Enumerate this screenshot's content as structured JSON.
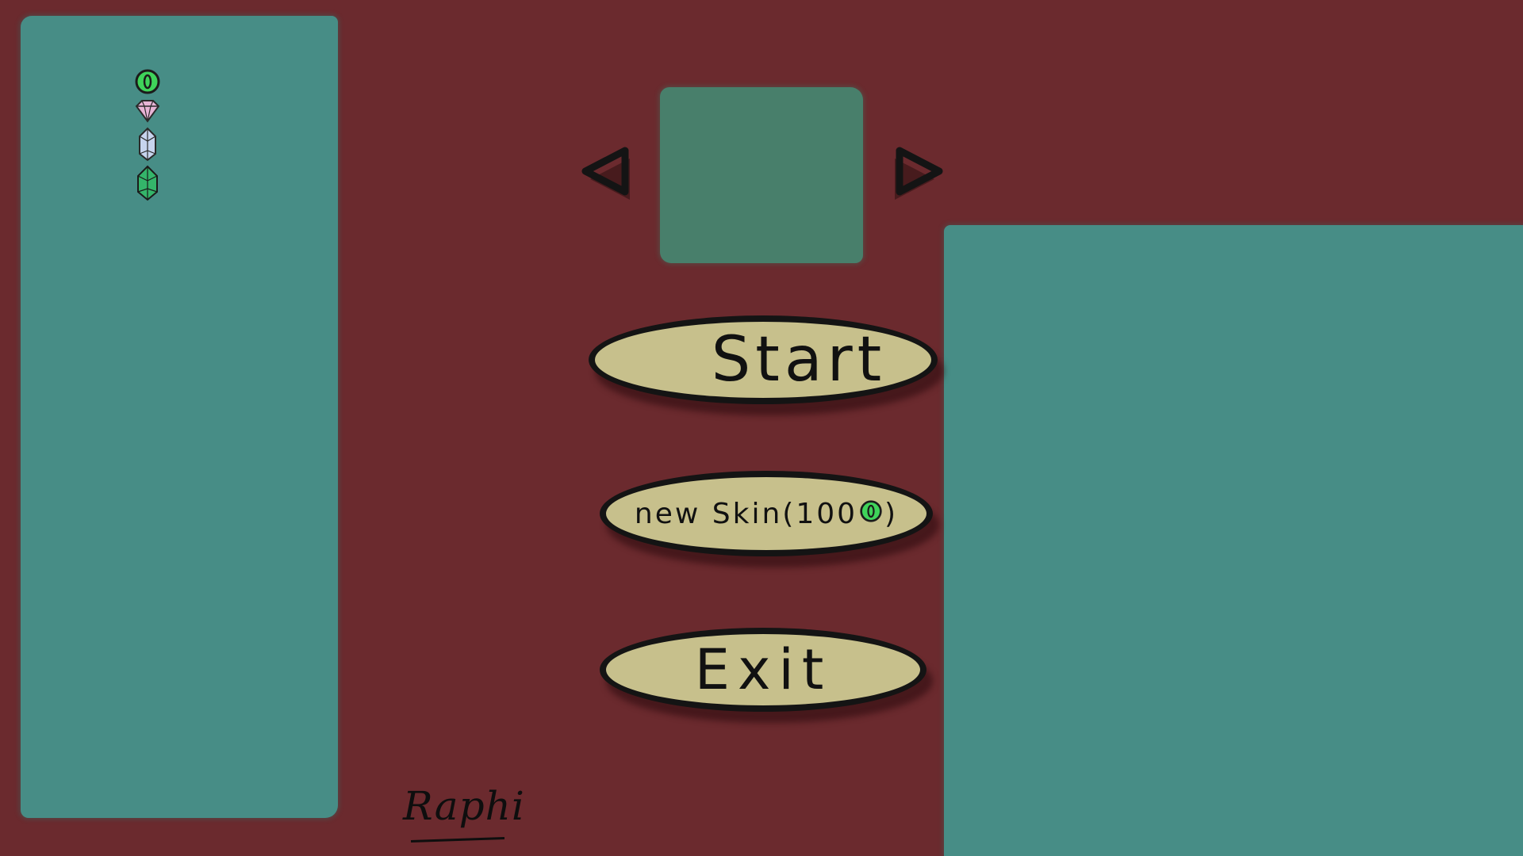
{
  "currencies": [
    {
      "name": "coin",
      "icon": "coin-icon",
      "color": "#3fd35a"
    },
    {
      "name": "pink-diamond",
      "icon": "pink-diamond-icon",
      "color": "#e7b4d6"
    },
    {
      "name": "blue-crystal",
      "icon": "blue-crystal-icon",
      "color": "#c7d4ee"
    },
    {
      "name": "green-emerald",
      "icon": "green-emerald-icon",
      "color": "#34b56a"
    }
  ],
  "skin_selector": {
    "prev_icon": "triangle-left-icon",
    "next_icon": "triangle-right-icon",
    "preview_color": "#487f6b"
  },
  "menu": {
    "start_label": "Start",
    "new_skin_label": "new Skin(100",
    "new_skin_close": ")",
    "new_skin_cost_icon": "coin-icon",
    "exit_label": "Exit"
  },
  "signature": "Raphi",
  "colors": {
    "background": "#6b2a2e",
    "panel": "#478d86",
    "button": "#c7c08c",
    "outline": "#141414"
  }
}
